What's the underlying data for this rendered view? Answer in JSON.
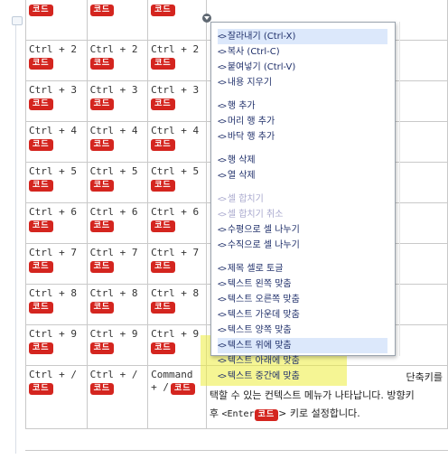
{
  "badge_label": "코드",
  "rows": [
    {
      "c1": "",
      "c2": "",
      "c3": ""
    },
    {
      "c1": "Ctrl + 2",
      "c2": "Ctrl + 2",
      "c3": "Ctrl + 2"
    },
    {
      "c1": "Ctrl + 3",
      "c2": "Ctrl + 3",
      "c3": "Ctrl + 3"
    },
    {
      "c1": "Ctrl + 4",
      "c2": "Ctrl + 4",
      "c3": "Ctrl + 4"
    },
    {
      "c1": "Ctrl + 5",
      "c2": "Ctrl + 5",
      "c3": "Ctrl + 5"
    },
    {
      "c1": "Ctrl + 6",
      "c2": "Ctrl + 6",
      "c3": "Ctrl + 6"
    },
    {
      "c1": "Ctrl + 7",
      "c2": "Ctrl + 7",
      "c3": "Ctrl + 7"
    },
    {
      "c1": "Ctrl + 8",
      "c2": "Ctrl + 8",
      "c3": "Ctrl + 8"
    },
    {
      "c1": "Ctrl + 9",
      "c2": "Ctrl + 9",
      "c3": "Ctrl + 9"
    },
    {
      "c1": "Ctrl + /",
      "c2": "Ctrl + /",
      "c3a": "Command",
      "c3b": "+ /"
    }
  ],
  "description": {
    "line1": "단축키를",
    "line2": "택할 수 있는 컨텍스트 메뉴가 나타납니다. 방향키",
    "line3_pre": "후 ",
    "line3_key": "<Enter",
    "line3_post": "> 키로 설정합니다."
  },
  "menu": {
    "icon": "<>",
    "items": [
      {
        "label": "잘라내기 (Ctrl-X)",
        "state": "selected"
      },
      {
        "label": "복사 (Ctrl-C)",
        "state": "normal"
      },
      {
        "label": "붙여넣기 (Ctrl-V)",
        "state": "normal"
      },
      {
        "label": "내용 지우기",
        "state": "normal"
      },
      {
        "label": "행 추가",
        "state": "normal"
      },
      {
        "label": "머리 행 추가",
        "state": "normal"
      },
      {
        "label": "바닥 행 추가",
        "state": "normal"
      },
      {
        "label": "행 삭제",
        "state": "normal"
      },
      {
        "label": "열 삭제",
        "state": "normal"
      },
      {
        "label": "셀 합치기",
        "state": "disabled"
      },
      {
        "label": "셀 합치기 취소",
        "state": "disabled"
      },
      {
        "label": "수평으로 셀 나누기",
        "state": "normal"
      },
      {
        "label": "수직으로 셀 나누기",
        "state": "normal"
      },
      {
        "label": "제목 셀로 토글",
        "state": "normal"
      },
      {
        "label": "텍스트 왼쪽 맞춤",
        "state": "normal"
      },
      {
        "label": "텍스트 오른쪽 맞춤",
        "state": "normal"
      },
      {
        "label": "텍스트 가운데 맞춤",
        "state": "normal"
      },
      {
        "label": "텍스트 양쪽 맞춤",
        "state": "normal"
      },
      {
        "label": "텍스트 위에 맞춤",
        "state": "selected"
      },
      {
        "label": "텍스트 아래에 맞춤",
        "state": "normal"
      },
      {
        "label": "텍스트 중간에 맞춤",
        "state": "normal"
      }
    ]
  },
  "colors": {
    "badge": "#d4251f",
    "menu_text": "#1f2f6a",
    "highlight": "#ecec3c"
  }
}
